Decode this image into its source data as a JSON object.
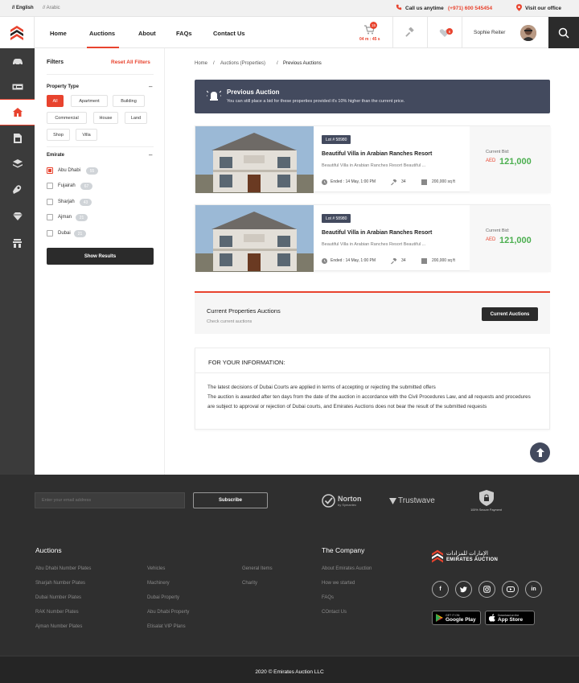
{
  "topbar": {
    "lang_english": "// English",
    "lang_arabic": "// Arabic",
    "call_label": "Call us anytime",
    "call_phone": "(+971) 600 545454",
    "visit_label": "Visit our office"
  },
  "nav": {
    "items": [
      {
        "label": "Home"
      },
      {
        "label": "Auctions"
      },
      {
        "label": "About"
      },
      {
        "label": "FAQs"
      },
      {
        "label": "Contact Us"
      }
    ],
    "active": "Auctions"
  },
  "header": {
    "cart_count": "15",
    "timer": "04 m : 45 s",
    "notif_count": "6",
    "user_name": "Sophie Reiter"
  },
  "filters": {
    "title": "Filters",
    "reset_label": "Reset All Filters",
    "property_type_title": "Property Type",
    "property_types": [
      "All",
      "Apartment",
      "Building",
      "Commercial",
      "House",
      "Land",
      "Shop",
      "Villa"
    ],
    "active_type": "All",
    "emirate_title": "Emirate",
    "emirates": [
      {
        "name": "Abu Dhabi",
        "count": "55",
        "checked": true
      },
      {
        "name": "Fujairah",
        "count": "67",
        "checked": false
      },
      {
        "name": "Sharjah",
        "count": "43",
        "checked": false
      },
      {
        "name": "Ajman",
        "count": "21",
        "checked": false
      },
      {
        "name": "Dubai",
        "count": "21",
        "checked": false
      }
    ],
    "show_results_label": "Show Results"
  },
  "breadcrumb": {
    "items": [
      "Home",
      "Auctions (Properties)",
      "Previous Auctions"
    ],
    "sep": "/"
  },
  "banner": {
    "title": "Previous Auction",
    "subtitle": "You can still place a bid for these properties provided it's 10% higher than the current price."
  },
  "cards": [
    {
      "lot": "Lot # 58980",
      "title": "Beautiful Villa in Arabian Ranches Resort",
      "desc": "Beautiful Villa in Arabian Ranches Resort Beautiful ...",
      "ended": "Ended : 14 May, 1:00 PM",
      "bids": "34",
      "area": "200,000 sq ft",
      "bid_label": "Current Bid:",
      "currency": "AED",
      "bid_value": "121,000"
    },
    {
      "lot": "Lot # 58980",
      "title": "Beautiful Villa in Arabian Ranches Resort",
      "desc": "Beautiful Villa in Arabian Ranches Resort Beautiful ...",
      "ended": "Ended : 14 May, 1:00 PM",
      "bids": "34",
      "area": "200,000 sq ft",
      "bid_label": "Current Bid:",
      "currency": "AED",
      "bid_value": "121,000"
    }
  ],
  "current": {
    "title": "Current Properties Auctions",
    "subtitle": "Check current auctions",
    "button": "Current Auctions"
  },
  "info": {
    "heading": "FOR YOUR INFORMATION:",
    "line1": "The latest decisions of Dubai Courts are applied in terms of accepting or rejecting the submitted offers",
    "line2": "The auction is awarded after ten days from the date of the auction in accordance with the Civil Procedures Law, and all requests and procedures are subject to approval or rejection of Dubai courts, and Emirates Auctions does not bear the result of the submitted requests"
  },
  "footer": {
    "email_placeholder": "Enter your email address",
    "subscribe": "Subscribe",
    "badges": {
      "norton": "Norton",
      "norton_sub": "by Symantec",
      "trustwave": "Trustwave",
      "secure": "100% Secure Payment"
    },
    "auctions_title": "Auctions",
    "col1": [
      "Abu Dhabi Number Plates",
      "Sharjah Number Plates",
      "Dubai Number Plates",
      "RAK Number Plates",
      "Ajman Number Plates"
    ],
    "col2": [
      "Vehicles",
      "Machinery",
      "Dubai Property",
      "Abu Dhabi Property",
      "Etisalat VIP Plans"
    ],
    "col3": [
      "General Items",
      "Charity"
    ],
    "company_title": "The Company",
    "company": [
      "About Emirates Auction",
      "How we started",
      "FAQs",
      "COntact Us"
    ],
    "brand_ar": "الإمارات للمزادات",
    "brand_en": "EMIRATES AUCTION",
    "google_small": "GET IT ON",
    "google_big": "Google Play",
    "apple_small": "Download on the",
    "apple_big": "App Store",
    "copyright": "2020 © Emirates Auction LLC"
  }
}
